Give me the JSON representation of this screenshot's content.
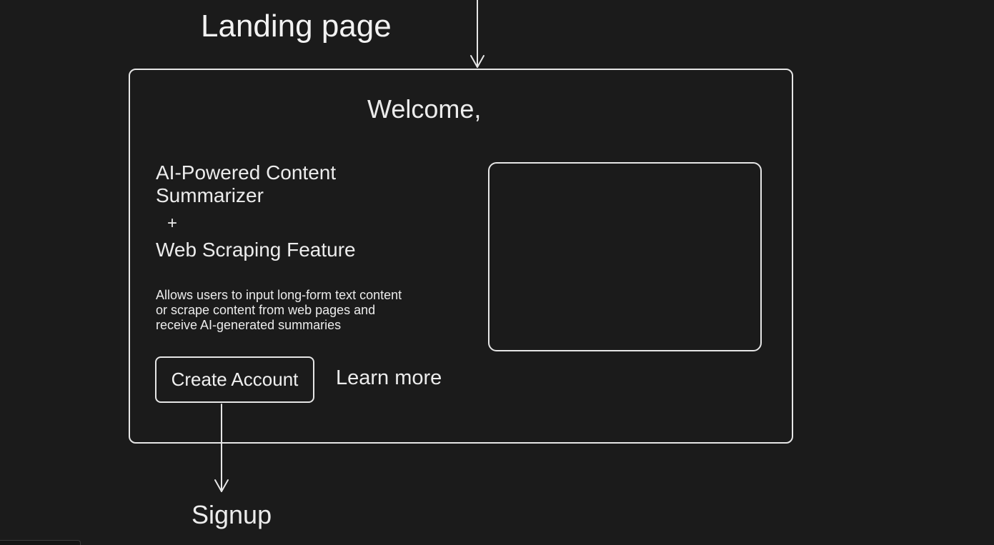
{
  "diagram": {
    "title": "Landing page",
    "welcome": "Welcome,",
    "headline_line1": "AI-Powered Content",
    "headline_line2": "Summarizer",
    "plus": "+",
    "feature": "Web Scraping Feature",
    "description_line1": "Allows users to input long-form text content",
    "description_line2": "or scrape content from web pages and",
    "description_line3": "receive AI-generated summaries",
    "primary_button": "Create Account",
    "secondary_link": "Learn more",
    "next_page": "Signup"
  },
  "colors": {
    "background": "#1b1b1b",
    "stroke": "#e6e6e6",
    "text": "#ececec"
  }
}
